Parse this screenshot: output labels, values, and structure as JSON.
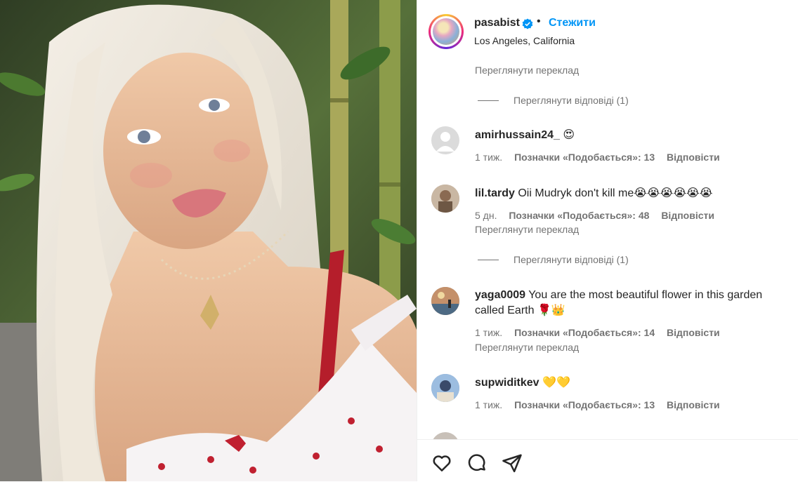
{
  "header": {
    "username": "pasabist",
    "separator": "•",
    "follow_label": "Стежити",
    "location": "Los Angeles, California"
  },
  "top_partial": {
    "translate_label": "Переглянути переклад",
    "view_replies_label": "Переглянути відповіді (1)"
  },
  "comments": [
    {
      "user": "amirhussain24_",
      "text": "",
      "emoji": "😍",
      "time": "1 тиж.",
      "likes": "Позначки «Подобається»: 13",
      "reply": "Відповісти",
      "translate": "",
      "view_replies": ""
    },
    {
      "user": "lil.tardy",
      "text": "Oii Mudryk don't kill me",
      "emoji": "😭😭😭😭😭😭",
      "time": "5 дн.",
      "likes": "Позначки «Подобається»: 48",
      "reply": "Відповісти",
      "translate": "Переглянути переклад",
      "view_replies": "Переглянути відповіді (1)"
    },
    {
      "user": "yaga0009",
      "text": "You are the most beautiful flower in this garden called Earth",
      "emoji": "🌹👑",
      "time": "1 тиж.",
      "likes": "Позначки «Подобається»: 14",
      "reply": "Відповісти",
      "translate": "Переглянути переклад",
      "view_replies": ""
    },
    {
      "user": "supwiditkev",
      "text": "",
      "emoji": "💛💛",
      "time": "1 тиж.",
      "likes": "Позначки «Подобається»: 13",
      "reply": "Відповісти",
      "translate": "",
      "view_replies": ""
    }
  ],
  "icons": {
    "like": "heart-icon",
    "comment": "comment-icon",
    "share": "share-icon",
    "verified": "verified-badge-icon"
  },
  "colors": {
    "accent": "#0095f6",
    "text": "#262626",
    "secondary": "#737373"
  }
}
